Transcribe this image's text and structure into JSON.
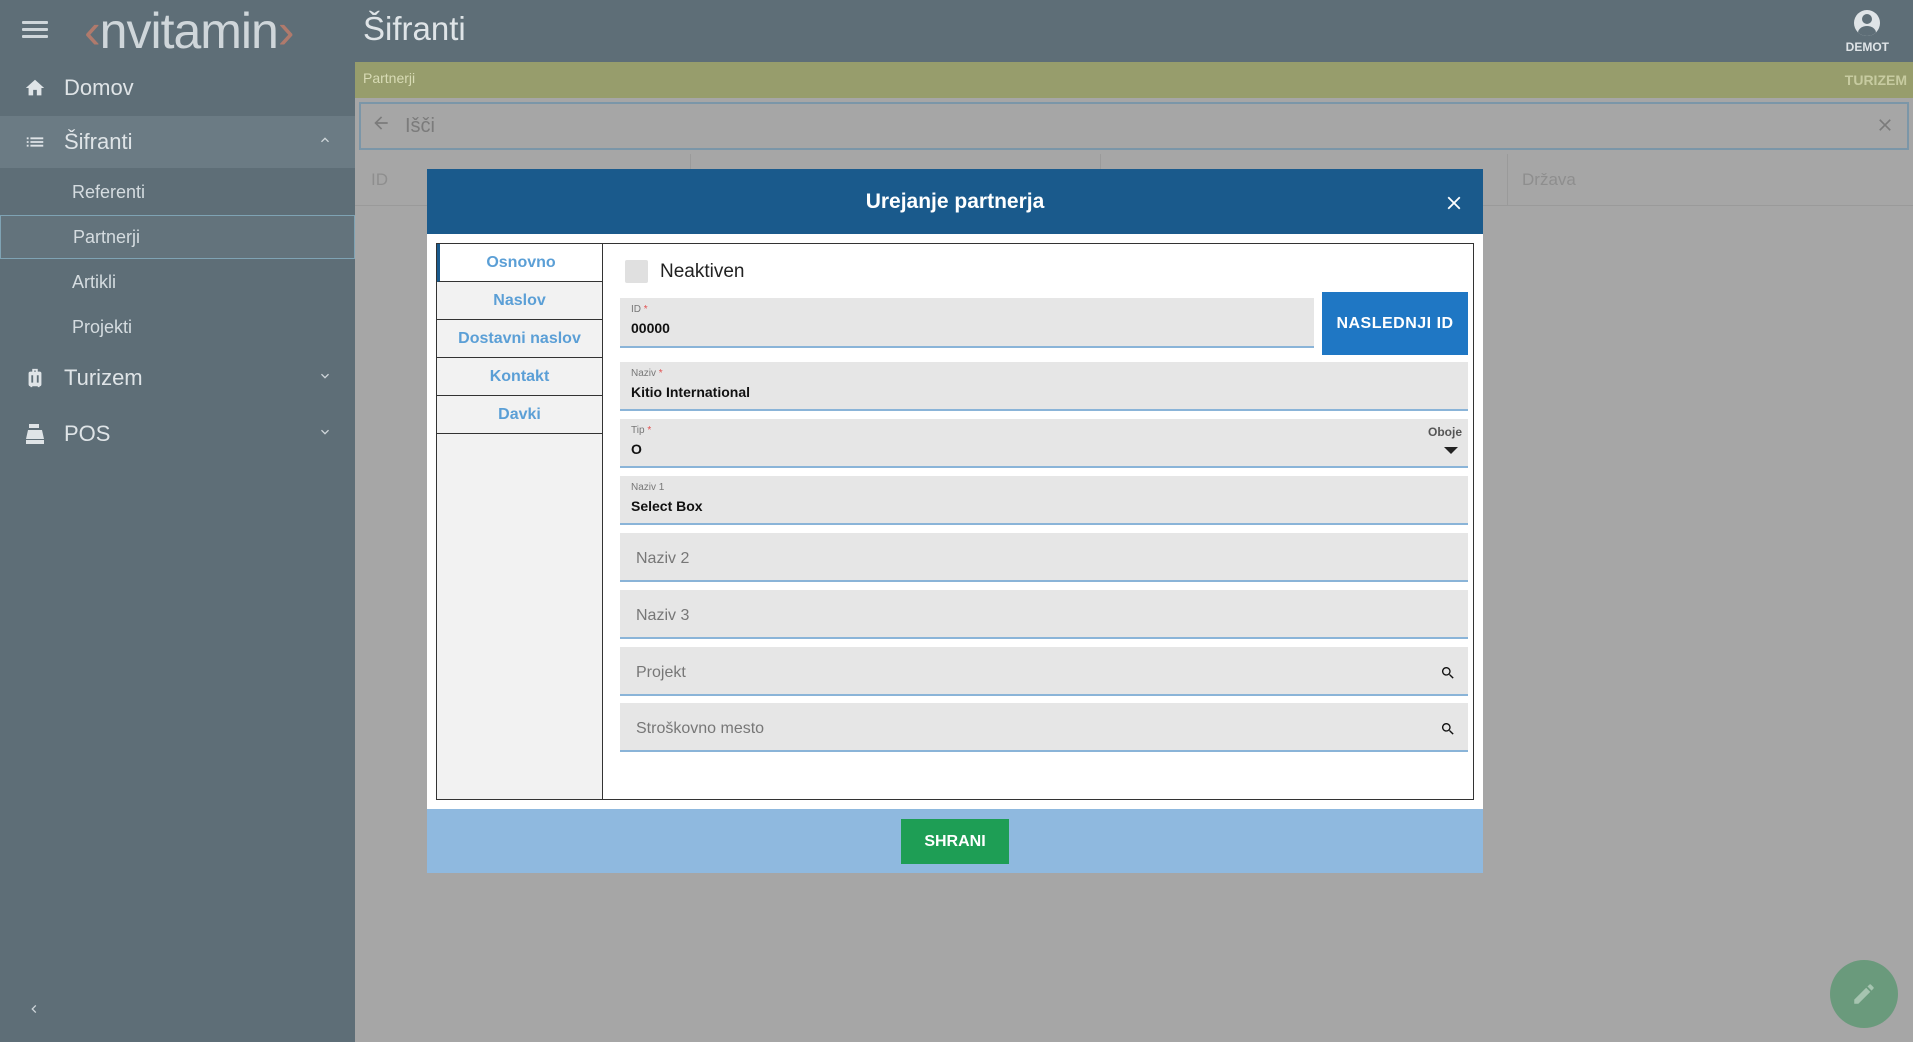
{
  "app": {
    "logo_text": "nvitamin",
    "page_title": "Šifranti",
    "user": "DEMOT"
  },
  "sidebar": {
    "items": [
      {
        "label": "Domov",
        "icon": "home-icon"
      },
      {
        "label": "Šifranti",
        "icon": "list-icon"
      },
      {
        "label": "Turizem",
        "icon": "luggage-icon"
      },
      {
        "label": "POS",
        "icon": "cash-register-icon"
      }
    ],
    "subitems": [
      "Referenti",
      "Partnerji",
      "Artikli",
      "Projekti"
    ],
    "active_subitem": "Partnerji"
  },
  "breadcrumb": {
    "current": "Partnerji",
    "module": "TURIZEM"
  },
  "search": {
    "placeholder": "Išči"
  },
  "table": {
    "columns": [
      "ID",
      "Država"
    ]
  },
  "modal": {
    "title": "Urejanje partnerja",
    "tabs": [
      "Osnovno",
      "Naslov",
      "Dostavni naslov",
      "Kontakt",
      "Davki"
    ],
    "active_tab": "Osnovno",
    "inactive_label": "Neaktiven",
    "fields": {
      "id": {
        "label": "ID",
        "value": "00000"
      },
      "naziv": {
        "label": "Naziv",
        "value": "Kitio International"
      },
      "tip": {
        "label": "Tip",
        "value": "O",
        "side": "Oboje"
      },
      "naziv1": {
        "label": "Naziv 1",
        "value": "Select Box"
      },
      "naziv2": {
        "placeholder": "Naziv 2"
      },
      "naziv3": {
        "placeholder": "Naziv 3"
      },
      "projekt": {
        "placeholder": "Projekt"
      },
      "strosek": {
        "placeholder": "Stroškovno mesto"
      }
    },
    "next_id_button": "NASLEDNJI ID",
    "save_button": "SHRANI"
  },
  "colors": {
    "header": "#1a5a8c",
    "next_button": "#1f77c4",
    "save_button": "#1e9e55",
    "footer": "#8fb9df"
  }
}
